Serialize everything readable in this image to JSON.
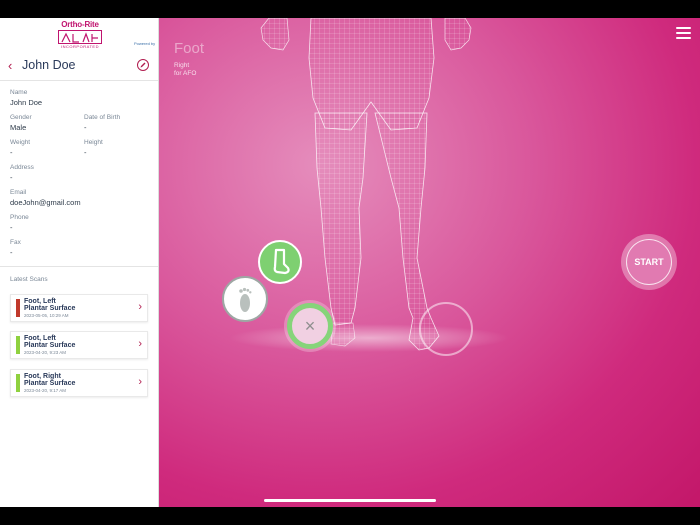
{
  "brand": {
    "name": "Ortho-Rite",
    "suffix": "INCORPORATED",
    "partner": "Powered by"
  },
  "patient": {
    "name": "John Doe",
    "fields": {
      "name_label": "Name",
      "name_value": "John Doe",
      "gender_label": "Gender",
      "gender_value": "Male",
      "dob_label": "Date of Birth",
      "dob_value": "-",
      "weight_label": "Weight",
      "weight_value": "-",
      "height_label": "Height",
      "height_value": "-",
      "address_label": "Address",
      "address_value": "-",
      "email_label": "Email",
      "email_value": "doeJohn@gmail.com",
      "phone_label": "Phone",
      "phone_value": "-",
      "fax_label": "Fax",
      "fax_value": "-"
    }
  },
  "latest_scans": {
    "heading": "Latest Scans",
    "items": [
      {
        "line1": "Foot, Left",
        "line2": "Plantar Surface",
        "date": "2023-05-05, 10:29 AM",
        "color": "#c0392b"
      },
      {
        "line1": "Foot, Left",
        "line2": "Plantar Surface",
        "date": "2023-04-20, 9:23 AM",
        "color": "#8fd13f"
      },
      {
        "line1": "Foot, Right",
        "line2": "Plantar Surface",
        "date": "2023-04-20, 9:17 AM",
        "color": "#8fd13f"
      }
    ]
  },
  "main": {
    "title": "Foot",
    "subtitle1": "Right",
    "subtitle2": "for AFO",
    "start_label": "START",
    "close_glyph": "×",
    "back_glyph": "‹",
    "chevron_glyph": "›"
  },
  "colors": {
    "accent": "#b11d4f",
    "background": "#cf2a7d",
    "green": "#7ed071"
  },
  "icons": [
    "back-icon",
    "edit-icon",
    "menu-icon",
    "sock-icon",
    "footprint-icon",
    "close-icon",
    "chevron-right-icon"
  ]
}
